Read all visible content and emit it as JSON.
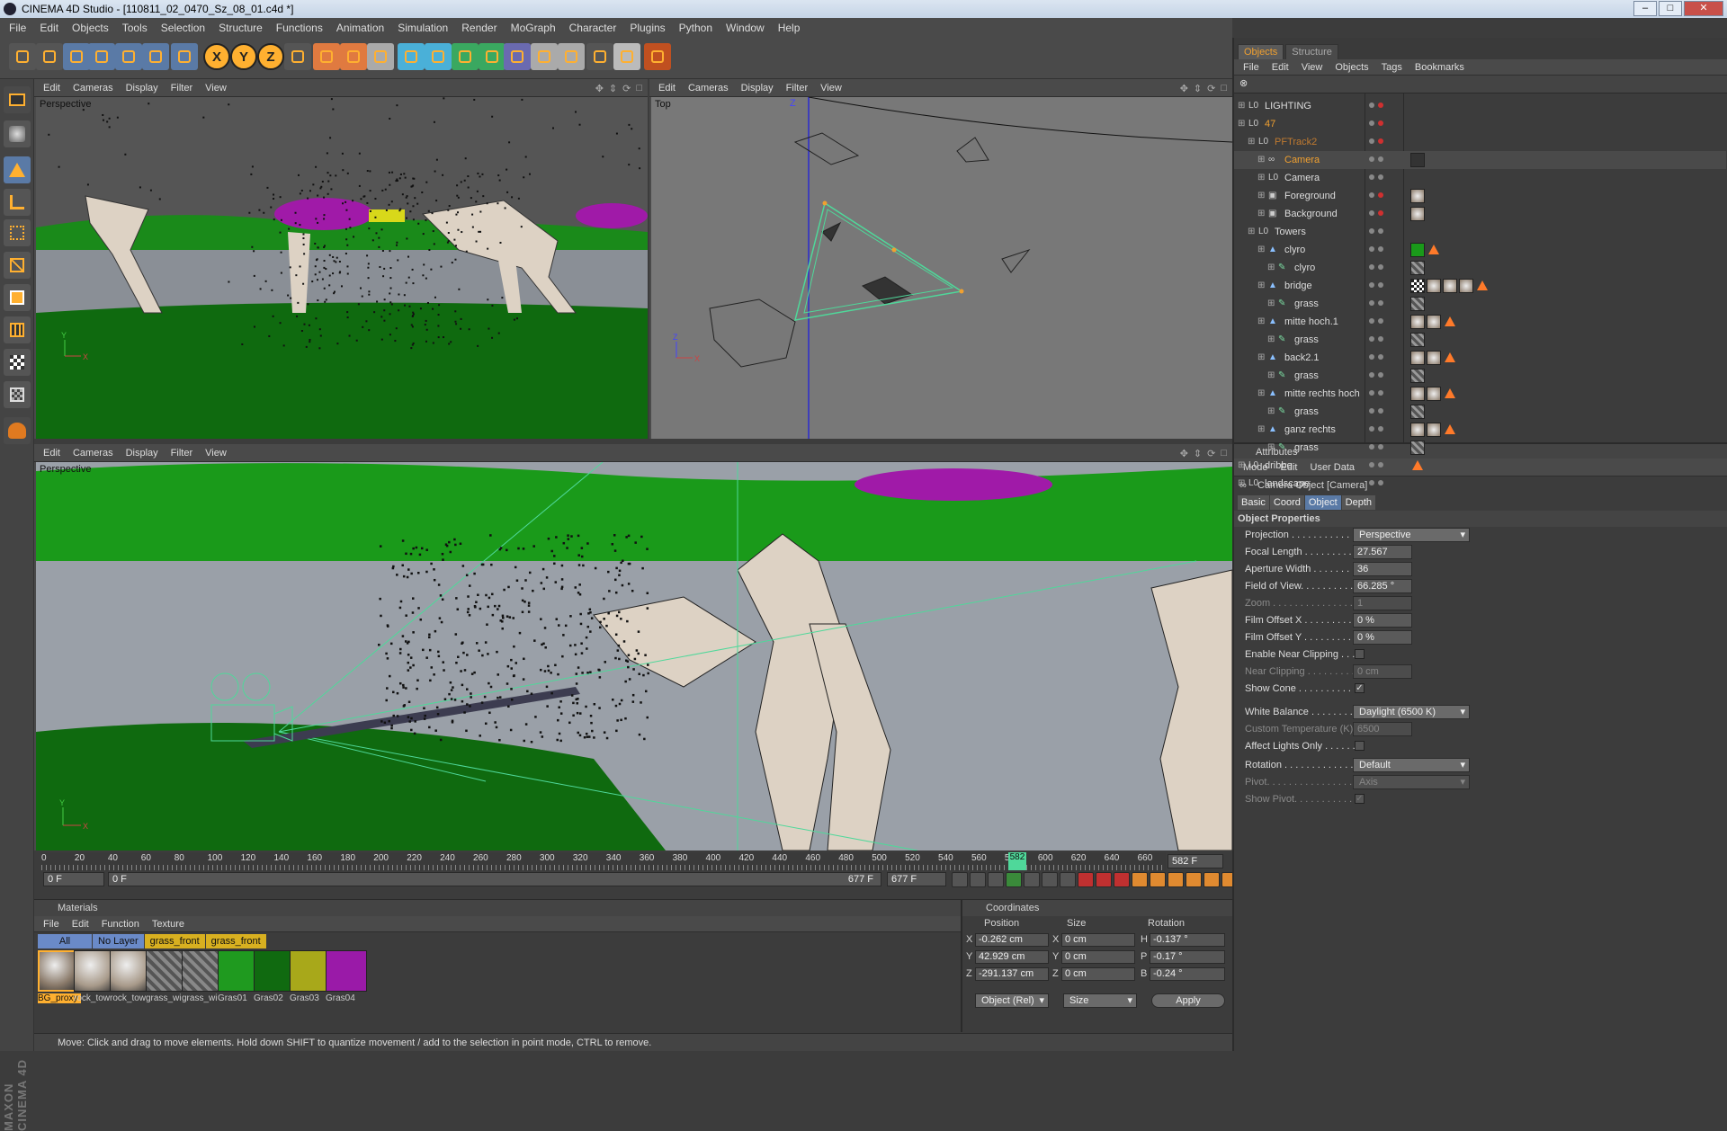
{
  "window": {
    "title": "CINEMA 4D Studio - [110811_02_0470_Sz_08_01.c4d *]",
    "minimize": "‒",
    "maximize": "□",
    "close": "✕"
  },
  "menubar": [
    "File",
    "Edit",
    "Objects",
    "Tools",
    "Selection",
    "Structure",
    "Functions",
    "Animation",
    "Simulation",
    "Render",
    "MoGraph",
    "Character",
    "Plugins",
    "Python",
    "Window",
    "Help"
  ],
  "toolbar": {
    "icons": [
      "undo-icon",
      "redo-icon",
      "live-selection-icon",
      "move-icon",
      "scale-icon",
      "rotate-icon",
      "last-tool-icon",
      "x-axis-icon",
      "y-axis-icon",
      "z-axis-icon",
      "coordinate-system-icon",
      "render-view-icon",
      "render-picture-viewer-icon",
      "render-settings-icon",
      "cube-icon",
      "spline-pen-icon",
      "subdivision-surface-icon",
      "array-icon",
      "deformer-icon",
      "scene-icon",
      "particle-icon",
      "help-icon",
      "layout-icon",
      "sphere-render-icon"
    ],
    "axis_x": "X",
    "axis_y": "Y",
    "axis_z": "Z"
  },
  "viewports": {
    "menu": [
      "Edit",
      "Cameras",
      "Display",
      "Filter",
      "View"
    ],
    "top_left": {
      "name": "Perspective"
    },
    "top_right": {
      "name": "Top"
    },
    "bottom": {
      "name": "Perspective"
    },
    "axis_labels": {
      "y": "Y",
      "x": "X",
      "z": "Z"
    }
  },
  "object_manager": {
    "tabs": [
      "Objects",
      "Structure"
    ],
    "menu": [
      "File",
      "Edit",
      "View",
      "Objects",
      "Tags",
      "Bookmarks"
    ],
    "rows": [
      {
        "name": "LIGHTING",
        "level": 0,
        "type": "null",
        "color": "#dddddd",
        "active": false
      },
      {
        "name": "47",
        "level": 0,
        "type": "null",
        "color": "#f0a030",
        "active": false
      },
      {
        "name": "PFTrack2",
        "level": 1,
        "type": "null",
        "color": "#c07a30",
        "active": false
      },
      {
        "name": "Camera",
        "level": 2,
        "type": "camera",
        "color": "#f0a030",
        "active": true
      },
      {
        "name": "Camera",
        "level": 2,
        "type": "null",
        "color": "#dddddd",
        "active": false
      },
      {
        "name": "Foreground",
        "level": 2,
        "type": "bg",
        "color": "#dddddd",
        "active": false
      },
      {
        "name": "Background",
        "level": 2,
        "type": "bg",
        "color": "#dddddd",
        "active": false
      },
      {
        "name": "Towers",
        "level": 1,
        "type": "null",
        "color": "#dddddd",
        "active": false
      },
      {
        "name": "clyro",
        "level": 2,
        "type": "poly",
        "color": "#dddddd",
        "active": false
      },
      {
        "name": "clyro",
        "level": 3,
        "type": "hair",
        "color": "#dddddd",
        "active": false
      },
      {
        "name": "bridge",
        "level": 2,
        "type": "poly",
        "color": "#dddddd",
        "active": false
      },
      {
        "name": "grass",
        "level": 3,
        "type": "hair",
        "color": "#dddddd",
        "active": false
      },
      {
        "name": "mitte hoch.1",
        "level": 2,
        "type": "poly",
        "color": "#dddddd",
        "active": false
      },
      {
        "name": "grass",
        "level": 3,
        "type": "hair",
        "color": "#dddddd",
        "active": false
      },
      {
        "name": "back2.1",
        "level": 2,
        "type": "poly",
        "color": "#dddddd",
        "active": false
      },
      {
        "name": "grass",
        "level": 3,
        "type": "hair",
        "color": "#dddddd",
        "active": false
      },
      {
        "name": "mitte rechts hoch",
        "level": 2,
        "type": "poly",
        "color": "#dddddd",
        "active": false
      },
      {
        "name": "grass",
        "level": 3,
        "type": "hair",
        "color": "#dddddd",
        "active": false
      },
      {
        "name": "ganz rechts",
        "level": 2,
        "type": "poly",
        "color": "#dddddd",
        "active": false
      },
      {
        "name": "grass",
        "level": 3,
        "type": "hair",
        "color": "#dddddd",
        "active": false
      },
      {
        "name": "dribbe",
        "level": 0,
        "type": "null",
        "color": "#dddddd",
        "active": false
      },
      {
        "name": "landscape",
        "level": 0,
        "type": "null",
        "color": "#dddddd",
        "active": false
      }
    ]
  },
  "attributes": {
    "header": "Attributes",
    "menu": [
      "Mode",
      "Edit",
      "User Data"
    ],
    "object_title": "Camera Object [Camera]",
    "tabs": [
      "Basic",
      "Coord",
      "Object",
      "Depth"
    ],
    "active_tab": "Object",
    "section": "Object Properties",
    "projection": {
      "label": "Projection . . . . . . . . . . . . .",
      "value": "Perspective"
    },
    "focal_length": {
      "label": "Focal Length . . . . . . . . . . .",
      "value": "27.567"
    },
    "aperture_width": {
      "label": "Aperture Width . . . . . . . . .",
      "value": "36"
    },
    "field_of_view": {
      "label": "Field of View. . . . . . . . . . .",
      "value": "66.285 °"
    },
    "zoom": {
      "label": "Zoom . . . . . . . . . . . . . . . . .",
      "value": "1"
    },
    "film_offset_x": {
      "label": "Film Offset X . . . . . . . . . .",
      "value": "0 %"
    },
    "film_offset_y": {
      "label": "Film Offset Y . . . . . . . . . .",
      "value": "0 %"
    },
    "enable_near_clipping": {
      "label": "Enable Near Clipping . . .",
      "checked": false
    },
    "near_clipping": {
      "label": "Near Clipping . . . . . . . . .",
      "value": "0 cm"
    },
    "show_cone": {
      "label": "Show Cone . . . . . . . . . . . .",
      "checked": true
    },
    "white_balance": {
      "label": "White Balance . . . . . . . . .",
      "value": "Daylight (6500 K)"
    },
    "custom_temperature": {
      "label": "Custom Temperature (K)",
      "value": "6500"
    },
    "affect_lights_only": {
      "label": "Affect Lights Only . . . . . .",
      "checked": false
    },
    "rotation": {
      "label": "Rotation . . . . . . . . . . . . .",
      "value": "Default"
    },
    "pivot": {
      "label": "Pivot. . . . . . . . . . . . . . . . .",
      "value": "Axis"
    },
    "show_pivot": {
      "label": "Show Pivot. . . . . . . . . . . .",
      "checked": true
    }
  },
  "timeline": {
    "ticks": [
      "0",
      "20",
      "40",
      "60",
      "80",
      "100",
      "120",
      "140",
      "160",
      "180",
      "200",
      "220",
      "240",
      "260",
      "280",
      "300",
      "320",
      "340",
      "360",
      "380",
      "400",
      "420",
      "440",
      "460",
      "480",
      "500",
      "520",
      "540",
      "560",
      "580",
      "600",
      "620",
      "640",
      "660"
    ],
    "current_frame": "582",
    "current_frame_label": "582 F",
    "start": "0 F",
    "range_start": "0 F",
    "range_end": "677 F",
    "end": "677 F",
    "max_frame": 677
  },
  "materials": {
    "header": "Materials",
    "menu": [
      "File",
      "Edit",
      "Function",
      "Texture"
    ],
    "filters": [
      "All",
      "No Layer",
      "grass_front",
      "grass_front"
    ],
    "items": [
      {
        "name": "BG_proxy",
        "color": "#8a7a6a",
        "selected": true
      },
      {
        "name": "rock_tow",
        "color": "#a89a8a",
        "selected": false
      },
      {
        "name": "rock_tow",
        "color": "#a89a8a",
        "selected": false
      },
      {
        "name": "grass_wi",
        "color": "#6a6a6a",
        "selected": false
      },
      {
        "name": "grass_wi",
        "color": "#6a6a6a",
        "selected": false
      },
      {
        "name": "Gras01",
        "color": "#1f9a1f",
        "selected": false
      },
      {
        "name": "Gras02",
        "color": "#106a10",
        "selected": false
      },
      {
        "name": "Gras03",
        "color": "#a8a81a",
        "selected": false
      },
      {
        "name": "Gras04",
        "color": "#9a1aa8",
        "selected": false
      }
    ]
  },
  "coordinates": {
    "header": "Coordinates",
    "cols": [
      "Position",
      "Size",
      "Rotation"
    ],
    "rows": [
      {
        "axis": "X",
        "pos": "-0.262 cm",
        "saxis": "X",
        "size": "0 cm",
        "raxis": "H",
        "rot": "-0.137 °"
      },
      {
        "axis": "Y",
        "pos": "42.929 cm",
        "saxis": "Y",
        "size": "0 cm",
        "raxis": "P",
        "rot": "-0.17 °"
      },
      {
        "axis": "Z",
        "pos": "-291.137 cm",
        "saxis": "Z",
        "size": "0 cm",
        "raxis": "B",
        "rot": "-0.24 °"
      }
    ],
    "mode": "Object (Rel)",
    "size_mode": "Size",
    "apply": "Apply"
  },
  "status": "Move: Click and drag to move elements. Hold down SHIFT to quantize movement / add to the selection in point mode, CTRL to remove.",
  "brand": "MAXON CINEMA 4D"
}
